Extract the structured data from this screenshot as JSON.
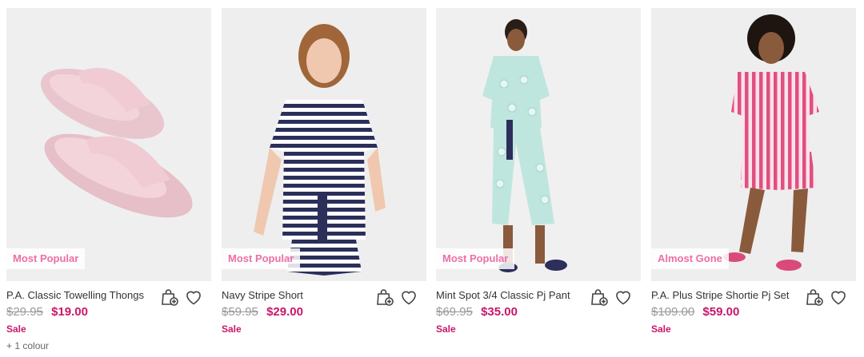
{
  "products": [
    {
      "name": "P.A. Classic Towelling Thongs",
      "badge": "Most Popular",
      "old_price": "$29.95",
      "price": "$19.00",
      "sale": "Sale",
      "colours": "+ 1 colour",
      "photo": "pink-towelling-thongs"
    },
    {
      "name": "Navy Stripe Short",
      "badge": "Most Popular",
      "old_price": "$59.95",
      "price": "$29.00",
      "sale": "Sale",
      "photo": "navy-stripe-pj-short"
    },
    {
      "name": "Mint Spot 3/4 Classic Pj Pant",
      "badge": "Most Popular",
      "old_price": "$69.95",
      "price": "$35.00",
      "sale": "Sale",
      "photo": "mint-spot-pj-pant"
    },
    {
      "name": "P.A. Plus Stripe Shortie Pj Set",
      "badge": "Almost Gone",
      "old_price": "$109.00",
      "price": "$59.00",
      "sale": "Sale",
      "photo": "pink-stripe-shortie-set"
    }
  ],
  "icons": {
    "add_to_bag": "bag-plus-icon",
    "wishlist": "heart-icon"
  },
  "colors": {
    "badge_text": "#ec6fa8",
    "sale_price": "#c8176a",
    "old_price": "#999999"
  }
}
